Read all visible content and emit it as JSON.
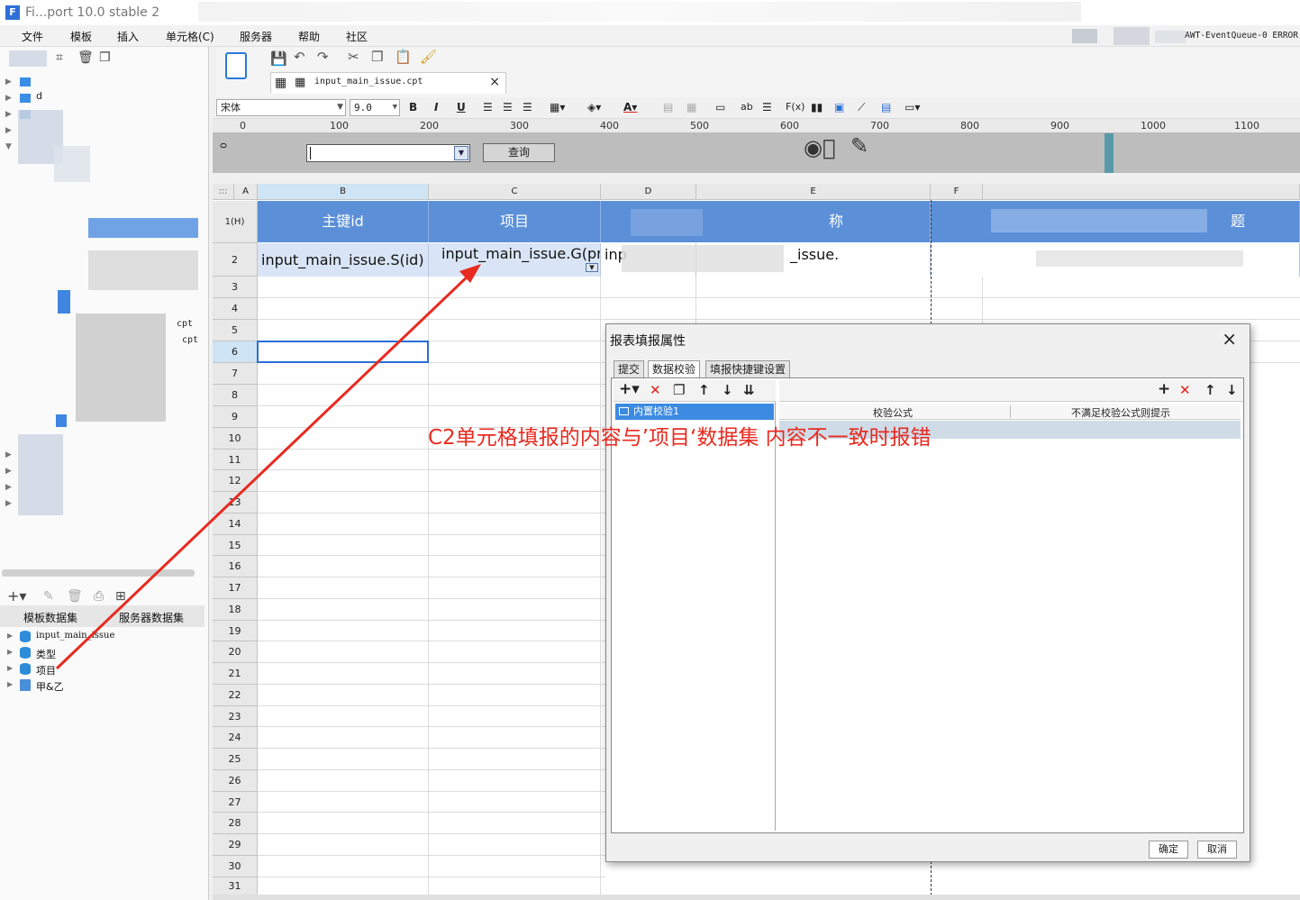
{
  "window": {
    "title": "Fi...port 10.0 stable 2"
  },
  "menu": {
    "items": [
      "文件",
      "模板",
      "插入",
      "单元格(C)",
      "服务器",
      "帮助",
      "社区"
    ],
    "error_text": "AWT-EventQueue-0 ERROR"
  },
  "file_tab": {
    "name": "input_main_issue.cpt"
  },
  "format_bar": {
    "font_name": "宋体",
    "font_size": "9.0",
    "bold": "B",
    "italic": "I",
    "underline": "U",
    "formula": "F(x)",
    "ab": "ab"
  },
  "ruler": {
    "ticks": [
      "0",
      "100",
      "200",
      "300",
      "400",
      "500",
      "600",
      "700",
      "800",
      "900",
      "1000",
      "1100"
    ]
  },
  "param_pane": {
    "query_button": "查询",
    "side_tick": "0"
  },
  "grid": {
    "columns": [
      "A",
      "B",
      "C",
      "D",
      "E",
      "F"
    ],
    "corner": ":::",
    "row_labels": [
      "1(H)",
      "2",
      "3",
      "4",
      "5",
      "6",
      "7",
      "8",
      "9",
      "10",
      "11",
      "12",
      "13",
      "14",
      "15",
      "16",
      "17",
      "18",
      "19",
      "20",
      "21",
      "22",
      "23",
      "24",
      "25",
      "26",
      "27",
      "28",
      "29",
      "30",
      "31"
    ],
    "header_row": {
      "B": "主键id",
      "C": "项目",
      "E": "称",
      "G": "题"
    },
    "data_row": {
      "B": "input_main_issue.S(id)",
      "C": "input_main_issue.G(project_id)",
      "D": "inp",
      "E": "_issue."
    }
  },
  "left_panel": {
    "tree_labels": [
      "d",
      "cpt",
      "cpt"
    ],
    "ds_tabs": [
      "模板数据集",
      "服务器数据集"
    ],
    "datasets": [
      {
        "label": "input_main_issue"
      },
      {
        "label": "类型"
      },
      {
        "label": "项目"
      },
      {
        "label": "甲&乙"
      }
    ]
  },
  "dialog": {
    "title": "报表填报属性",
    "close": "×",
    "tabs": [
      "提交",
      "数据校验",
      "填报快捷键设置"
    ],
    "active_tab": "数据校验",
    "rules": [
      "内置校验1"
    ],
    "columns": [
      "校验公式",
      "不满足校验公式则提示"
    ],
    "ok": "确定",
    "cancel": "取消"
  },
  "annotation": {
    "text": "C2单元格填报的内容与’项目‘数据集 内容不一致时报错",
    "color": "#e82a20"
  },
  "colors": {
    "header_blue": "#5b8fd8",
    "data_blue": "#d9e5f6",
    "selection": "#2a6fd6"
  }
}
